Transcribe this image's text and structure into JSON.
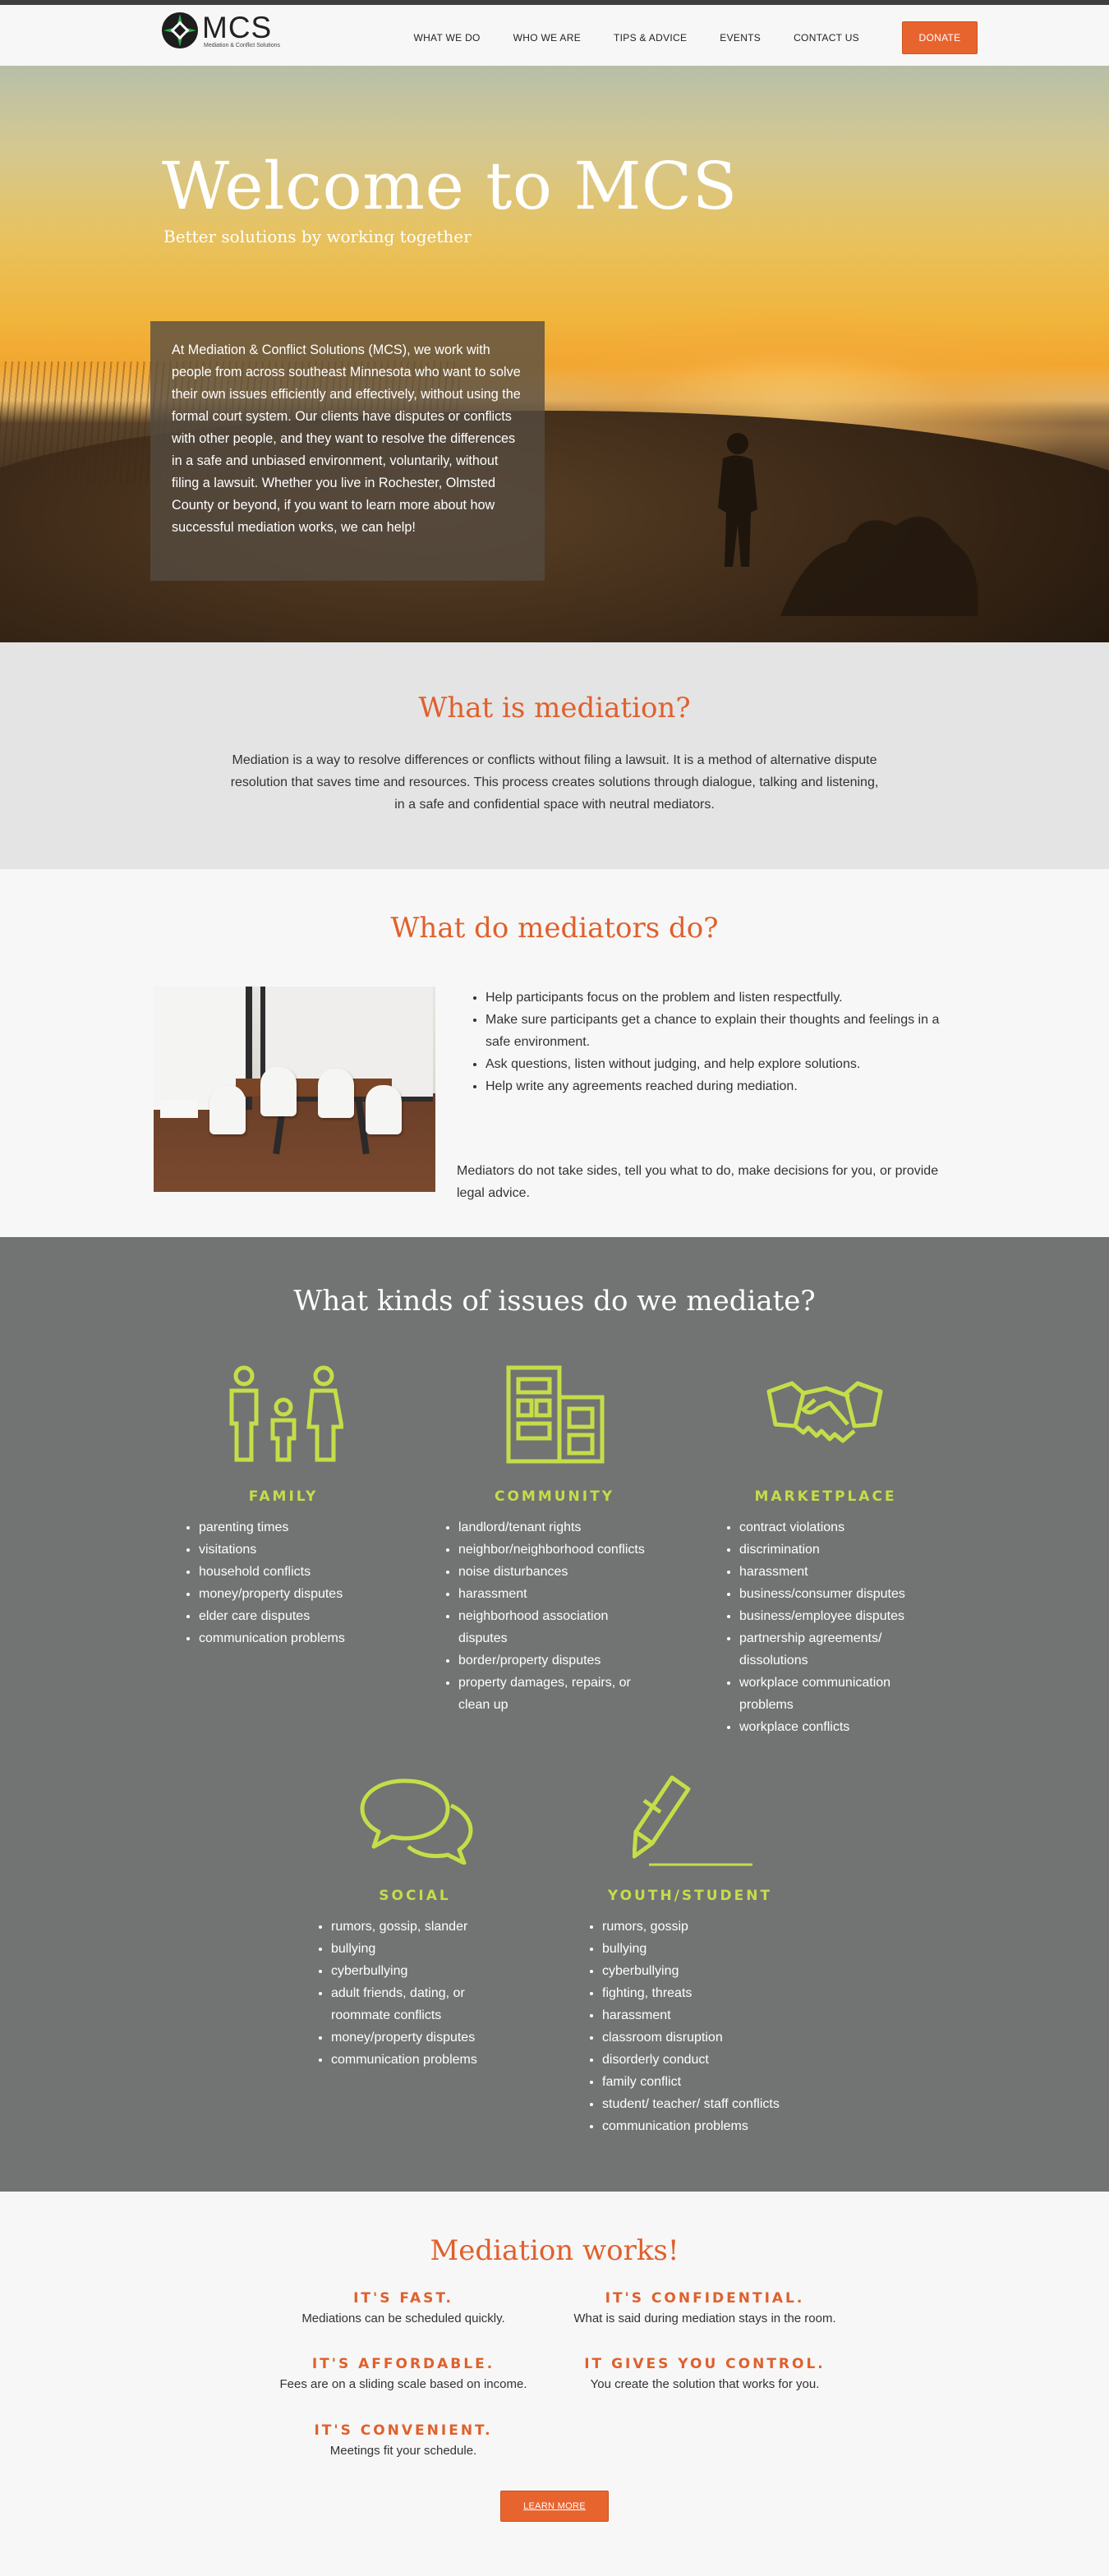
{
  "header": {
    "logo_title": "MCS",
    "logo_subtitle": "Mediation & Conflict Solutions",
    "nav": [
      "WHAT WE DO",
      "WHO WE ARE",
      "TIPS & ADVICE",
      "EVENTS",
      "CONTACT US"
    ],
    "donate_label": "DONATE"
  },
  "hero": {
    "title": "Welcome to MCS",
    "subtitle": "Better solutions by working together",
    "intro": "At Mediation & Conflict Solutions (MCS), we work with people from across southeast Minnesota who want to solve their own issues efficiently and effectively, without using the formal court system.  Our clients have disputes or conflicts with other people, and they want to resolve the differences in a safe and unbiased environment, voluntarily, without filing a lawsuit.  Whether you live in Rochester, Olmsted County or beyond, if you want to learn more about how successful mediation works, we can help!"
  },
  "what_is": {
    "title": "What is mediation?",
    "text": "Mediation is a way to resolve differences or conflicts without filing a lawsuit. It is a method of alternative dispute resolution that saves time and resources. This process creates solutions through dialogue, talking and listening, in a safe and confidential space with neutral mediators."
  },
  "mediators_do": {
    "title": "What do mediators do?",
    "items": [
      "Help participants focus on the problem and listen respectfully.",
      "Make sure participants get a chance to explain their thoughts and feelings in a safe environment.",
      "Ask questions, listen without judging, and help explore solutions.",
      "Help write any agreements reached during mediation."
    ],
    "note": "Mediators do not take sides, tell you what to do, make decisions for you, or provide legal advice."
  },
  "issues": {
    "title": "What kinds of issues do we mediate?",
    "accent_color": "#c5dd49",
    "categories": [
      {
        "name": "FAMILY",
        "icon": "family-icon",
        "items": [
          "parenting times",
          "visitations",
          "household conflicts",
          "money/property disputes",
          "elder care disputes",
          "communication problems"
        ]
      },
      {
        "name": "COMMUNITY",
        "icon": "buildings-icon",
        "items": [
          "landlord/tenant rights",
          "neighbor/neighborhood conflicts",
          "noise disturbances",
          "harassment",
          "neighborhood association disputes",
          "border/property disputes",
          "property damages, repairs, or clean up"
        ]
      },
      {
        "name": "MARKETPLACE",
        "icon": "handshake-icon",
        "items": [
          "contract violations",
          "discrimination",
          "harassment",
          "business/consumer disputes",
          "business/employee disputes",
          "partnership agreements/ dissolutions",
          "workplace communication problems",
          "workplace conflicts"
        ]
      },
      {
        "name": "SOCIAL",
        "icon": "speech-bubbles-icon",
        "items": [
          "rumors, gossip, slander",
          "bullying",
          "cyberbullying",
          "adult friends, dating, or roommate conflicts",
          "money/property disputes",
          "communication problems"
        ]
      },
      {
        "name": "YOUTH/STUDENT",
        "icon": "pencil-icon",
        "items": [
          "rumors, gossip",
          "bullying",
          "cyberbullying",
          "fighting, threats",
          "harassment",
          "classroom disruption",
          "disorderly conduct",
          "family conflict",
          "student/ teacher/ staff conflicts",
          "communication problems"
        ]
      }
    ]
  },
  "works": {
    "title": "Mediation works!",
    "points": [
      {
        "heading": "IT'S FAST.",
        "text": "Mediations can be scheduled quickly."
      },
      {
        "heading": "IT'S CONFIDENTIAL.",
        "text": "What is said during mediation stays in the room."
      },
      {
        "heading": "IT'S AFFORDABLE.",
        "text": "Fees are on a sliding scale based on income."
      },
      {
        "heading": "IT GIVES YOU CONTROL.",
        "text": "You create the solution that works for you."
      },
      {
        "heading": "IT'S CONVENIENT.",
        "text": "Meetings fit your schedule."
      }
    ],
    "button_label": "LEARN MORE"
  },
  "colors": {
    "accent": "#e8642f",
    "dark_band": "#727373",
    "light_band": "#e4e4e4"
  }
}
